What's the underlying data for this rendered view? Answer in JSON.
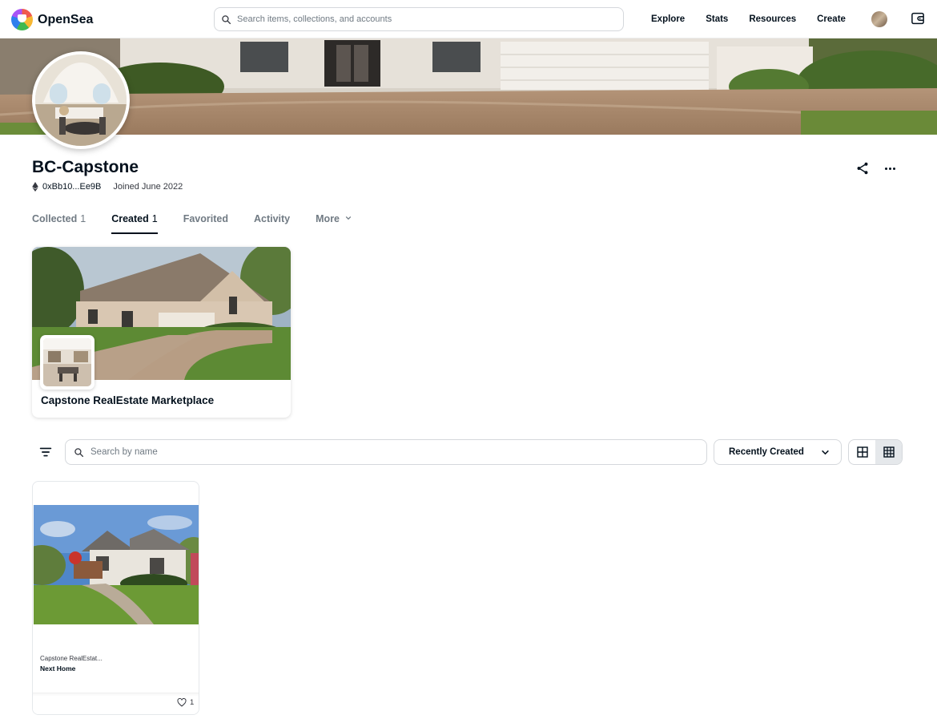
{
  "nav": {
    "brand": "OpenSea",
    "search_placeholder": "Search items, collections, and accounts",
    "links": [
      "Explore",
      "Stats",
      "Resources",
      "Create"
    ]
  },
  "profile": {
    "name": "BC-Capstone",
    "address": "0xBb10...Ee9B",
    "joined": "Joined June 2022"
  },
  "tabs": [
    {
      "label": "Collected",
      "count": "1"
    },
    {
      "label": "Created",
      "count": "1"
    },
    {
      "label": "Favorited",
      "count": ""
    },
    {
      "label": "Activity",
      "count": ""
    },
    {
      "label": "More",
      "count": ""
    }
  ],
  "active_tab": "Created",
  "collection": {
    "name": "Capstone RealEstate Marketplace"
  },
  "items_toolbar": {
    "search_placeholder": "Search by name",
    "sort_label": "Recently Created"
  },
  "nft": {
    "collection": "Capstone RealEstat...",
    "title": "Next Home",
    "likes": "1"
  },
  "colors": {
    "text": "#04111d",
    "muted": "#707a83",
    "border": "#d5d8dc"
  }
}
